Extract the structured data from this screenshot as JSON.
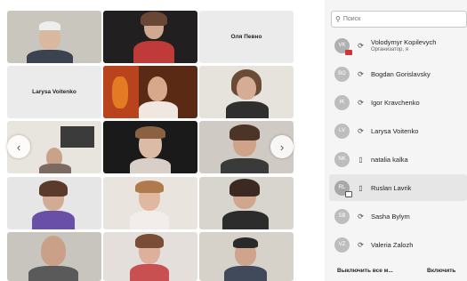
{
  "grid": {
    "name_tiles": [
      "Оля Певно",
      "Larysa Voitenko"
    ],
    "nav_prev": "‹",
    "nav_next": "›"
  },
  "panel": {
    "search_placeholder": "Поиск",
    "participants": [
      {
        "initials": "VK",
        "name": "Volodymyr Kopilevych",
        "role": "Организатор, я",
        "device": "phone-icon"
      },
      {
        "initials": "BG",
        "name": "Bogdan Gorislavsky",
        "device": "phone-icon"
      },
      {
        "initials": "IK",
        "name": "Igor Kravchenko",
        "device": "phone-icon"
      },
      {
        "initials": "LV",
        "name": "Larysa Voitenko",
        "device": "phone-icon"
      },
      {
        "initials": "NK",
        "name": "natalia kalka",
        "device": "mobile-icon"
      },
      {
        "initials": "RL",
        "name": "Ruslan Lavrik",
        "device": "mobile-icon"
      },
      {
        "initials": "SB",
        "name": "Sasha Bylym",
        "device": "phone-icon"
      },
      {
        "initials": "VZ",
        "name": "Valeria Zalozh",
        "device": "phone-icon"
      }
    ],
    "footer_left": "Выключить все м...",
    "footer_right": "Включить"
  }
}
